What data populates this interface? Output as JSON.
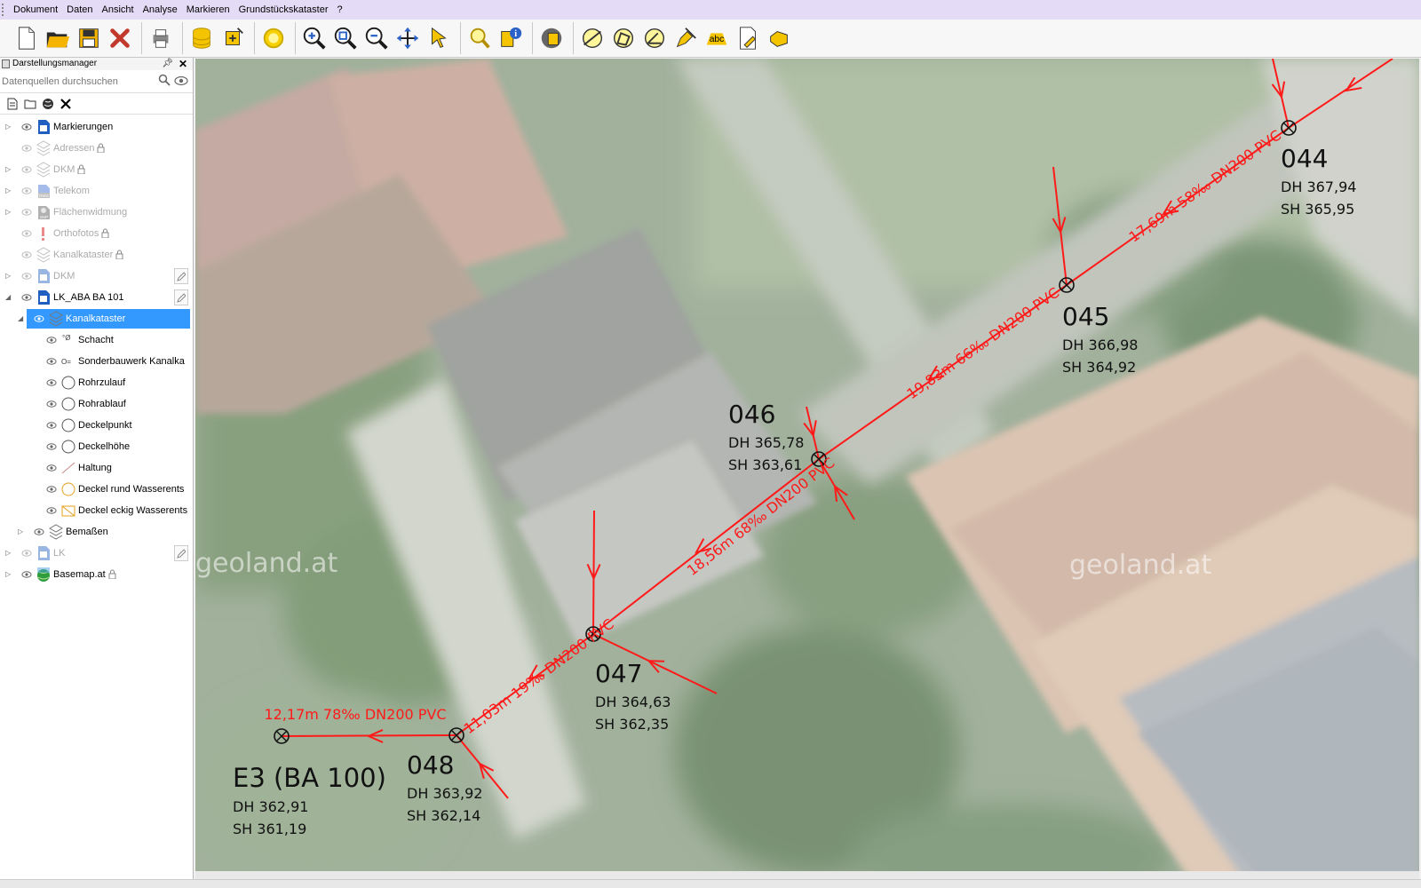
{
  "menu": [
    "Dokument",
    "Daten",
    "Ansicht",
    "Analyse",
    "Markieren",
    "Grundstückskataster",
    "?"
  ],
  "toolbar": {
    "groups": [
      [
        "new-document-icon",
        "open-folder-icon",
        "save-icon",
        "delete-icon"
      ],
      [
        "print-icon"
      ],
      [
        "database-icon",
        "add-data-icon"
      ],
      [
        "highlight-icon"
      ],
      [
        "zoom-in-icon",
        "zoom-extent-icon",
        "zoom-out-icon",
        "pan-icon",
        "select-arrow-icon"
      ],
      [
        "search-feature-icon",
        "info-icon"
      ],
      [
        "layer-tool-icon"
      ],
      [
        "measure-distance-icon",
        "measure-area-icon",
        "measure-angle-icon",
        "edit-tool-icon",
        "text-label-icon",
        "document-edit-icon",
        "hand-pointer-icon"
      ]
    ]
  },
  "panel": {
    "title": "Darstellungsmanager",
    "search_placeholder": "Datenquellen durchsuchen",
    "layers": [
      {
        "label": "Markierungen",
        "dim": false,
        "level": 0,
        "lock": false,
        "edit": false,
        "expand": "▷",
        "icon": "doc-blue-icon"
      },
      {
        "label": "Adressen",
        "dim": true,
        "level": 0,
        "lock": true,
        "edit": false,
        "expand": "",
        "icon": "stack-icon"
      },
      {
        "label": "DKM",
        "dim": true,
        "level": 0,
        "lock": true,
        "edit": false,
        "expand": "▷",
        "icon": "stack-icon"
      },
      {
        "label": "Telekom",
        "dim": true,
        "level": 0,
        "lock": false,
        "edit": false,
        "expand": "▷",
        "icon": "dwg-icon"
      },
      {
        "label": "Flächenwidmung",
        "dim": true,
        "level": 0,
        "lock": false,
        "edit": false,
        "expand": "▷",
        "icon": "shp-icon"
      },
      {
        "label": "Orthofotos",
        "dim": true,
        "level": 0,
        "lock": true,
        "edit": false,
        "expand": "",
        "icon": "error-icon"
      },
      {
        "label": "Kanalkataster",
        "dim": true,
        "level": 0,
        "lock": true,
        "edit": false,
        "expand": "",
        "icon": "stack-icon"
      },
      {
        "label": "DKM",
        "dim": true,
        "level": 0,
        "lock": false,
        "edit": true,
        "expand": "▷",
        "icon": "doc-blue-icon"
      },
      {
        "label": "LK_ABA BA 101",
        "dim": false,
        "level": 0,
        "lock": false,
        "edit": true,
        "expand": "◢",
        "icon": "doc-blue-icon"
      },
      {
        "label": "Kanalkataster",
        "dim": false,
        "level": 1,
        "lock": false,
        "edit": false,
        "expand": "◢",
        "icon": "stack-icon",
        "selected": true
      },
      {
        "label": "Schacht",
        "dim": false,
        "level": 2,
        "lock": false,
        "edit": false,
        "expand": "",
        "icon": "schacht-icon"
      },
      {
        "label": "Sonderbauwerk Kanalka",
        "dim": false,
        "level": 2,
        "lock": false,
        "edit": false,
        "expand": "",
        "icon": "sonderbauwerk-icon"
      },
      {
        "label": "Rohrzulauf",
        "dim": false,
        "level": 2,
        "lock": false,
        "edit": false,
        "expand": "",
        "icon": "circle-icon"
      },
      {
        "label": "Rohrablauf",
        "dim": false,
        "level": 2,
        "lock": false,
        "edit": false,
        "expand": "",
        "icon": "circle-icon"
      },
      {
        "label": "Deckelpunkt",
        "dim": false,
        "level": 2,
        "lock": false,
        "edit": false,
        "expand": "",
        "icon": "circle-icon"
      },
      {
        "label": "Deckelhöhe",
        "dim": false,
        "level": 2,
        "lock": false,
        "edit": false,
        "expand": "",
        "icon": "circle-icon"
      },
      {
        "label": "Haltung",
        "dim": false,
        "level": 2,
        "lock": false,
        "edit": false,
        "expand": "",
        "icon": "line-icon"
      },
      {
        "label": "Deckel rund Wasserents",
        "dim": false,
        "level": 2,
        "lock": false,
        "edit": false,
        "expand": "",
        "icon": "orange-circle-icon"
      },
      {
        "label": "Deckel eckig Wasserents",
        "dim": false,
        "level": 2,
        "lock": false,
        "edit": false,
        "expand": "",
        "icon": "orange-square-icon"
      },
      {
        "label": "Bemaßen",
        "dim": false,
        "level": 1,
        "lock": false,
        "edit": false,
        "expand": "▷",
        "icon": "stack-icon"
      },
      {
        "label": "LK",
        "dim": true,
        "level": 0,
        "lock": false,
        "edit": true,
        "expand": "▷",
        "icon": "doc-blue-icon"
      },
      {
        "label": "Basemap.at",
        "dim": false,
        "level": 0,
        "lock": true,
        "edit": false,
        "expand": "▷",
        "icon": "globe-icon"
      }
    ]
  },
  "map": {
    "watermarks": [
      "geoland.at",
      "geoland.at"
    ],
    "manholes": [
      {
        "id": "044",
        "dh": "DH 367,94",
        "sh": "SH 365,95"
      },
      {
        "id": "045",
        "dh": "DH 366,98",
        "sh": "SH 364,92"
      },
      {
        "id": "046",
        "dh": "DH 365,78",
        "sh": "SH 363,61"
      },
      {
        "id": "047",
        "dh": "DH 364,63",
        "sh": "SH 362,35"
      },
      {
        "id": "048",
        "dh": "DH 363,92",
        "sh": "SH 362,14"
      },
      {
        "id": "E3 (BA 100)",
        "dh": "DH 362,91",
        "sh": "SH 361,19"
      }
    ],
    "segments": [
      "17,69m 58‰ DN200 PVC",
      "19,83m 66‰ DN200 PVC",
      "18,56m 68‰ DN200 PVC",
      "11,03m 19‰ DN200 PVC",
      "12,17m 78‰ DN200 PVC"
    ],
    "line_color": "#ff1a1a"
  }
}
